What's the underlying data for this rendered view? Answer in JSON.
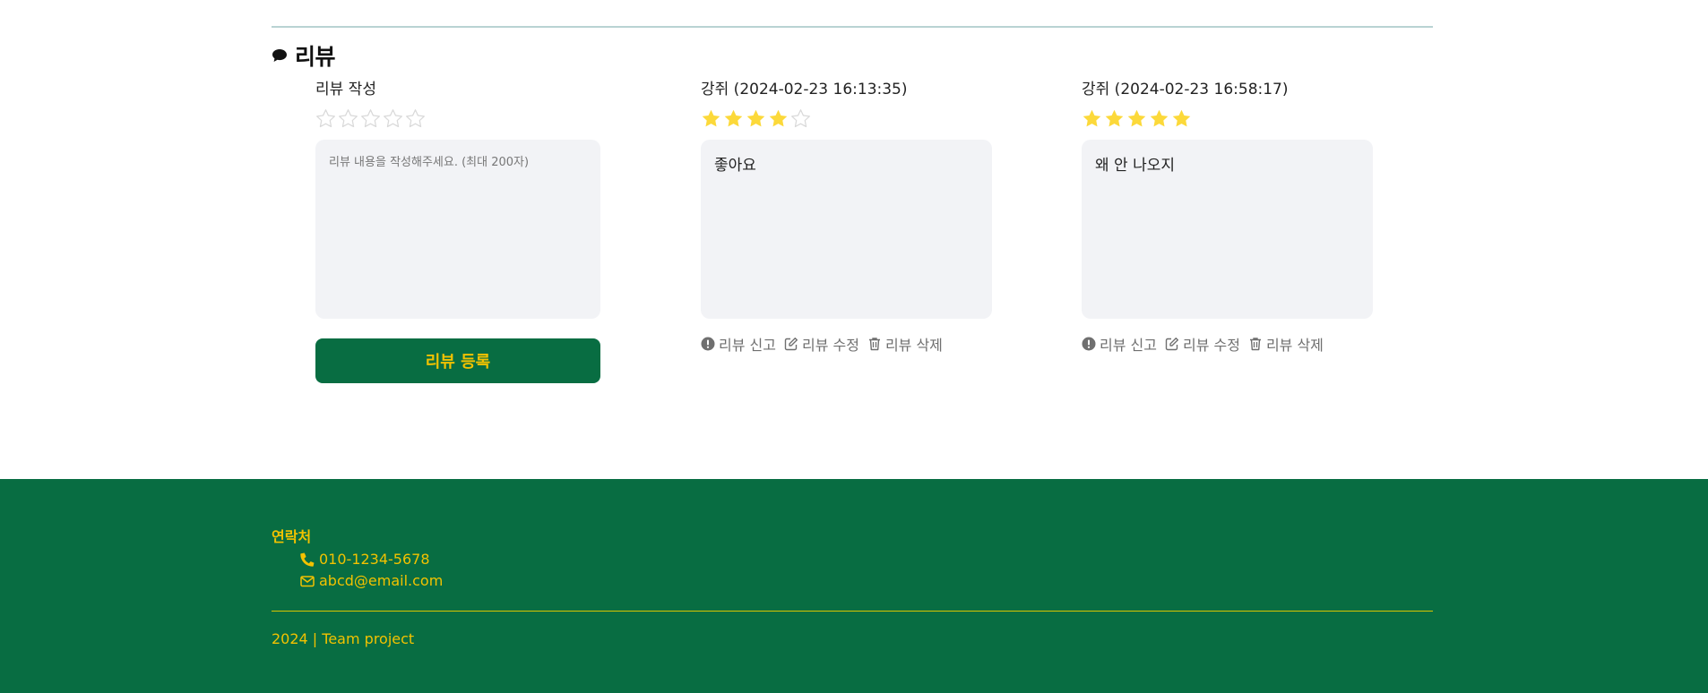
{
  "section": {
    "title": "리뷰",
    "icon": "chat-bubble-icon"
  },
  "write": {
    "label": "리뷰 작성",
    "rating": 0,
    "placeholder": "리뷰 내용을 작성해주세요. (최대 200자)",
    "submit_label": "리뷰 등록"
  },
  "reviews": [
    {
      "header": "강쥐 (2024-02-23 16:13:35)",
      "rating": 4,
      "content": "좋아요",
      "actions": {
        "report": "리뷰 신고",
        "edit": "리뷰 수정",
        "delete": "리뷰 삭제"
      }
    },
    {
      "header": "강쥐 (2024-02-23 16:58:17)",
      "rating": 5,
      "content": "왜 안 나오지",
      "actions": {
        "report": "리뷰 신고",
        "edit": "리뷰 수정",
        "delete": "리뷰 삭제"
      }
    }
  ],
  "footer": {
    "title": "연락처",
    "phone": "010-1234-5678",
    "email": "abcd@email.com",
    "copyright": "2024 | Team project"
  },
  "colors": {
    "brand_green": "#086d42",
    "accent_yellow": "#f2c200",
    "star_filled": "#fcd93a",
    "star_empty_outline": "#d9d9d9",
    "muted_text": "#6f6f6f"
  }
}
